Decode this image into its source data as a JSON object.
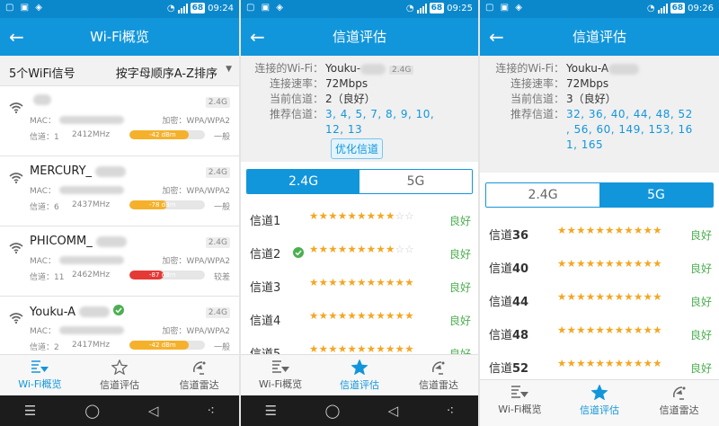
{
  "screens": [
    {
      "status": {
        "time": "09:24",
        "battery": "68"
      },
      "title": "Wi-Fi概览",
      "list_header": {
        "count": "5个WiFi信号",
        "sort": "按字母顺序A-Z排序"
      },
      "wifi_list": [
        {
          "band": "2.4G",
          "mac_label": "MAC：",
          "enc": "加密：WPA/WPA2",
          "channel": "信道：1",
          "freq": "2412MHz",
          "dbm": "-42 dBm",
          "quality": "一般",
          "strength": 0.78,
          "color": "#f5b12c",
          "connected": false
        },
        {
          "ssid": "MERCURY_",
          "band": "2.4G",
          "mac_label": "MAC：",
          "enc": "加密：WPA/WPA2",
          "channel": "信道：6",
          "freq": "2437MHz",
          "dbm": "-78 dBm",
          "quality": "一般",
          "strength": 0.5,
          "color": "#f5b12c",
          "connected": false
        },
        {
          "ssid": "PHICOMM_",
          "band": "2.4G",
          "mac_label": "MAC：",
          "enc": "加密：WPA/WPA2",
          "channel": "信道：11",
          "freq": "2462MHz",
          "dbm": "-87 dBm",
          "quality": "较差",
          "strength": 0.45,
          "color": "#e53935",
          "connected": false
        },
        {
          "ssid": "Youku-A",
          "band": "2.4G",
          "mac_label": "MAC：",
          "enc": "加密：WPA/WPA2",
          "channel": "信道：2",
          "freq": "2417MHz",
          "dbm": "-42 dBm",
          "quality": "一般",
          "strength": 0.78,
          "color": "#f5b12c",
          "connected": true
        }
      ],
      "tabs": [
        "Wi-Fi概览",
        "信道评估",
        "信道雷达"
      ],
      "active_tab": 0
    },
    {
      "status": {
        "time": "09:25",
        "battery": "68"
      },
      "title": "信道评估",
      "info": {
        "wifi_label": "连接的Wi-Fi：",
        "wifi_value": "Youku-",
        "wifi_band": "2.4G",
        "rate_label": "连接速率：",
        "rate_value": "72Mbps",
        "cur_label": "当前信道：",
        "cur_value": "2（良好）",
        "rec_label": "推荐信道：",
        "rec_line1": "3, 4, 5, 7, 8, 9, 10,",
        "rec_line2": "12, 13"
      },
      "optimize_label": "优化信道",
      "segment": [
        "2.4G",
        "5G"
      ],
      "segment_active": 0,
      "channels": [
        {
          "name": "信道1",
          "stars_filled": 9,
          "stars_total": 11,
          "rating": "良好",
          "current": false
        },
        {
          "name": "信道2",
          "stars_filled": 9,
          "stars_total": 11,
          "rating": "良好",
          "current": true
        },
        {
          "name": "信道3",
          "stars_filled": 11,
          "stars_total": 11,
          "rating": "良好",
          "current": false
        },
        {
          "name": "信道4",
          "stars_filled": 11,
          "stars_total": 11,
          "rating": "良好",
          "current": false
        },
        {
          "name": "信道5",
          "stars_filled": 11,
          "stars_total": 11,
          "rating": "良好",
          "current": false
        }
      ],
      "tabs": [
        "Wi-Fi概览",
        "信道评估",
        "信道雷达"
      ],
      "active_tab": 1
    },
    {
      "status": {
        "time": "09:26",
        "battery": "68"
      },
      "title": "信道评估",
      "info": {
        "wifi_label": "连接的Wi-Fi：",
        "wifi_value": "Youku-A",
        "rate_label": "连接速率：",
        "rate_value": "72Mbps",
        "cur_label": "当前信道：",
        "cur_value": "3（良好）",
        "rec_label": "推荐信道：",
        "rec_line1": "32, 36, 40, 44, 48, 52",
        "rec_line2": ", 56, 60, 149, 153, 16",
        "rec_line3": "1, 165"
      },
      "segment": [
        "2.4G",
        "5G"
      ],
      "segment_active": 1,
      "channels": [
        {
          "prefix": "信道",
          "num": "36",
          "stars_filled": 11,
          "stars_total": 11,
          "rating": "良好"
        },
        {
          "prefix": "信道",
          "num": "40",
          "stars_filled": 11,
          "stars_total": 11,
          "rating": "良好"
        },
        {
          "prefix": "信道",
          "num": "44",
          "stars_filled": 11,
          "stars_total": 11,
          "rating": "良好"
        },
        {
          "prefix": "信道",
          "num": "48",
          "stars_filled": 11,
          "stars_total": 11,
          "rating": "良好"
        },
        {
          "prefix": "信道",
          "num": "52",
          "stars_filled": 11,
          "stars_total": 11,
          "rating": "良好"
        }
      ],
      "tabs": [
        "Wi-Fi概览",
        "信道评估",
        "信道雷达"
      ],
      "active_tab": 1
    }
  ],
  "colors": {
    "primary": "#1296db",
    "star": "#f5a623",
    "good": "#4caf50",
    "bad": "#e53935",
    "warn": "#f5b12c"
  },
  "icons": [
    "back-arrow-icon",
    "wifi-icon",
    "check-circle-icon",
    "wifi-overview-icon",
    "star-icon",
    "radar-icon",
    "menu-icon",
    "home-icon",
    "back-triangle-icon",
    "assist-icon"
  ]
}
